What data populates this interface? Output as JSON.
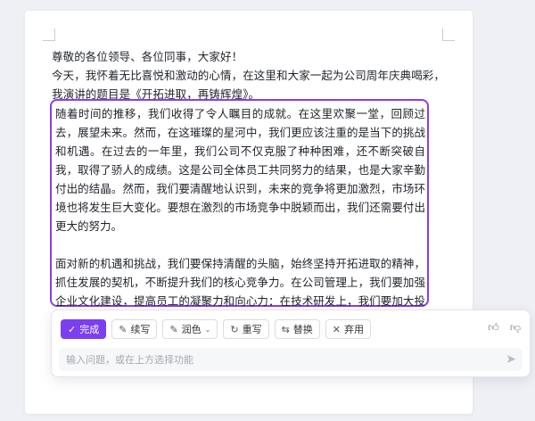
{
  "document": {
    "intro_lines": [
      "尊敬的各位领导、各位同事，大家好！",
      "今天，我怀着无比喜悦和激动的心情，在这里和大家一起为公司周年庆典喝彩，",
      "我演讲的题目是《开拓进取，再铸辉煌》。"
    ],
    "selected_paragraphs": [
      "随着时间的推移，我们收得了令人瞩目的成就。在这里欢聚一堂，回顾过去，展望未来。然而，在这璀璨的星河中，我们更应该注重的是当下的挑战和机遇。在过去的一年里，我们公司不仅克服了种种困难，还不断突破自我，取得了骄人的成绩。这是公司全体员工共同努力的结果，也是大家辛勤付出的结晶。然而，我们要清醒地认识到，未来的竞争将更加激烈，市场环境也将发生巨大变化。要想在激烈的市场竞争中脱颖而出，我们还需要付出更大的努力。",
      "面对新的机遇和挑战，我们要保持清醒的头脑，始终坚持开拓进取的精神，抓住发展的契机，不断提升我们的核心竞争力。在公司管理上，我们要加强企业文化建设，提高员工的凝聚力和向心力：在技术研发上，我们要加大投入，持续提高产品的技术水平和质量，在市场拓展上，我们要积极开拓新市场，提高市场占有率。"
    ]
  },
  "ai_panel": {
    "buttons": {
      "done": "完成",
      "continue": "续写",
      "polish": "润色",
      "rewrite": "重写",
      "replace": "替换",
      "discard": "弃用"
    },
    "input_placeholder": "输入问题，或在上方选择功能"
  },
  "colors": {
    "accent": "#7b3ef0",
    "selection_border": "#8a3cf0"
  }
}
